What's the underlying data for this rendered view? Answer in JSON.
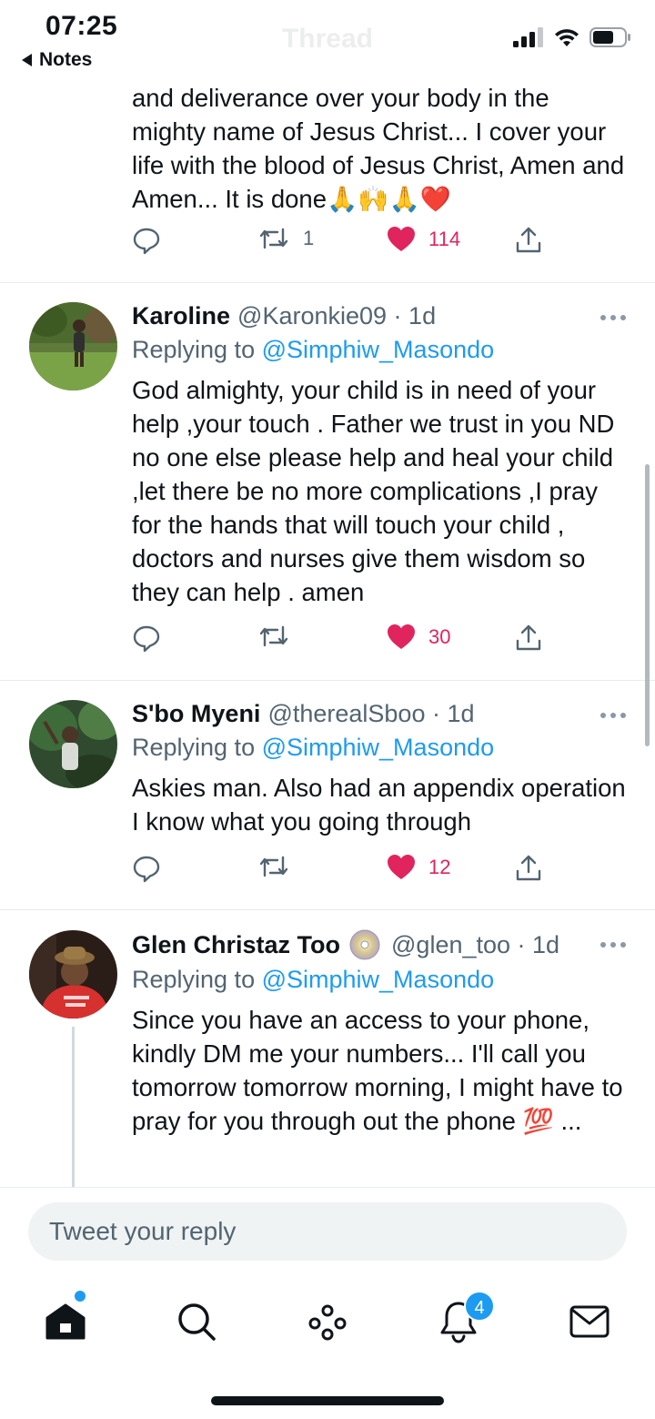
{
  "status_bar": {
    "time": "07:25",
    "back_app": "Notes",
    "title": "Thread"
  },
  "partial_tweet": {
    "text": "and deliverance over your body in the mighty name of Jesus Christ... I cover your life with the blood of Jesus Christ, Amen and Amen... It is done🙏🙌🙏❤️",
    "retweets": "1",
    "likes": "114",
    "liked": true
  },
  "tweets": [
    {
      "name": "Karoline",
      "handle": "@Karonkie09",
      "time": "1d",
      "replying_label": "Replying to",
      "replying_to": "@Simphiw_Masondo",
      "text": "God almighty, your child is in need of your help ,your touch . Father we trust in you ND no one else please help and heal your child ,let there be no more complications ,I pray for the hands that will touch your child , doctors and nurses give them wisdom so they can help . amen",
      "retweets": "",
      "likes": "30",
      "liked": true
    },
    {
      "name": "S'bo Myeni",
      "handle": "@therealSboo",
      "time": "1d",
      "replying_label": "Replying to",
      "replying_to": "@Simphiw_Masondo",
      "text": "Askies man. Also had an appendix operation I know what you going through",
      "retweets": "",
      "likes": "12",
      "liked": true
    },
    {
      "name": "Glen Christaz Too",
      "name_icon": "disc-icon",
      "handle": "@glen_too",
      "time": "1d",
      "replying_label": "Replying to",
      "replying_to": "@Simphiw_Masondo",
      "text": "Since you have an access to your phone, kindly DM me your numbers... I'll call you tomorrow tomorrow morning, I might have to pray for you through out the phone 💯 ..."
    }
  ],
  "reply_box": {
    "placeholder": "Tweet your reply"
  },
  "tab_bar": {
    "notifications_badge": "4"
  },
  "colors": {
    "accent": "#1d9bf0",
    "like": "#e0245e",
    "secondary_text": "#536471"
  }
}
